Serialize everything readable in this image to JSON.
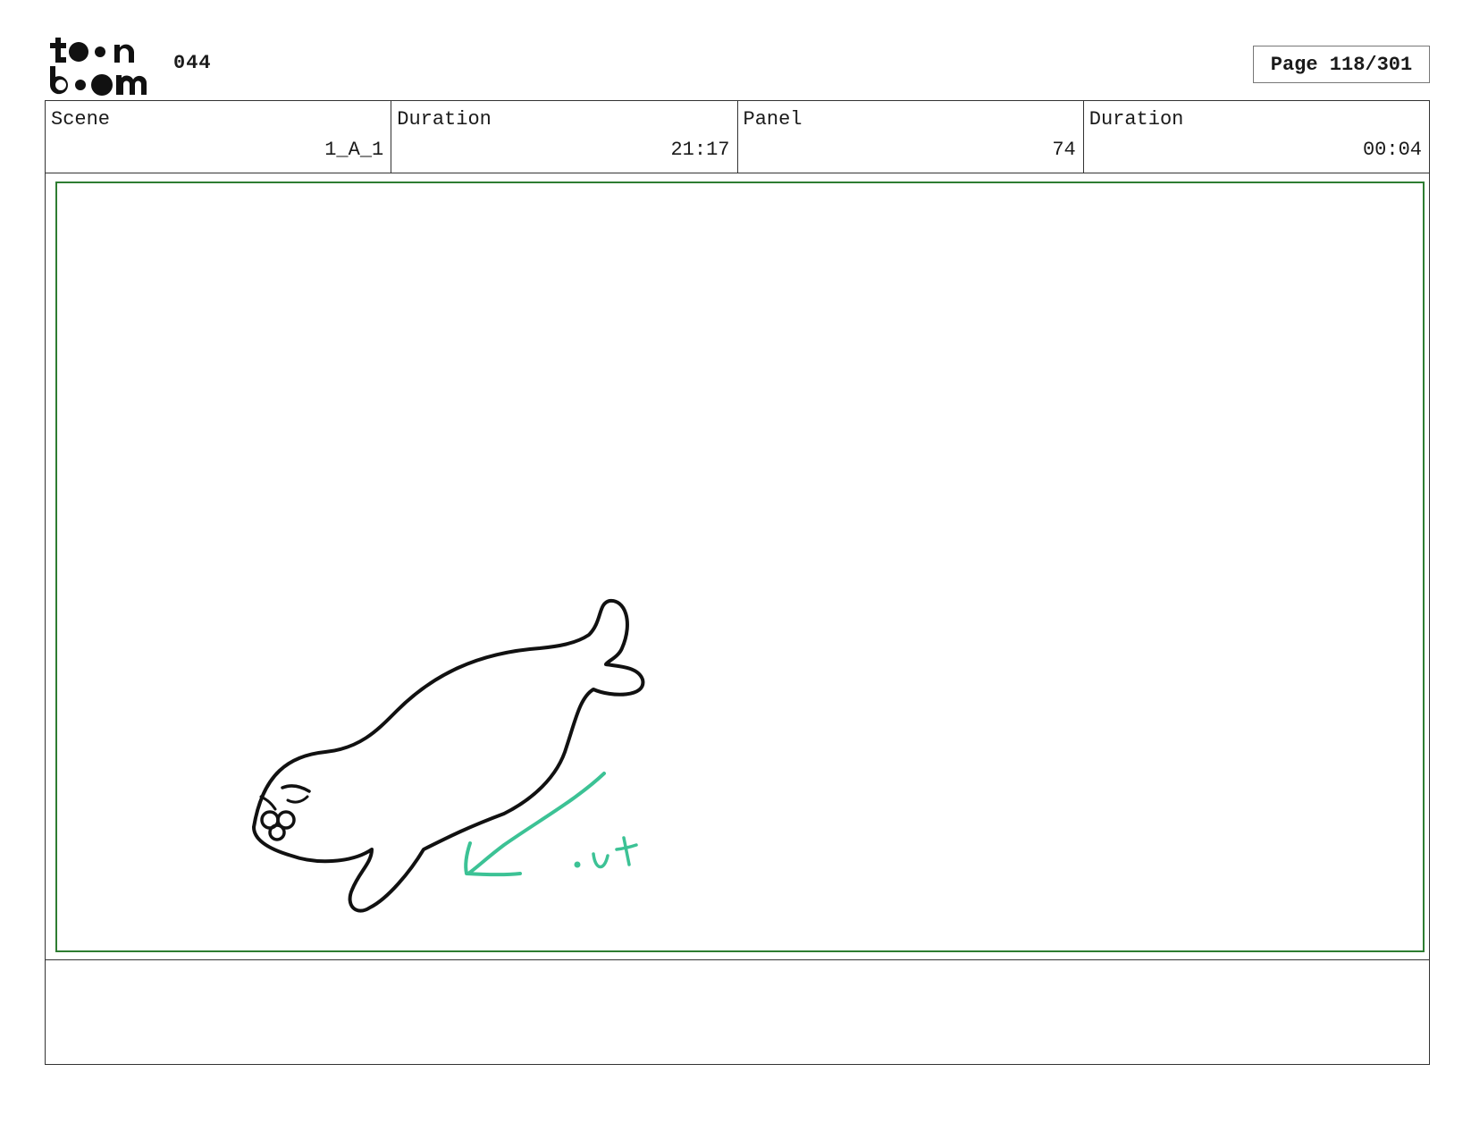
{
  "header": {
    "logo": {
      "line1": "toon",
      "line2": "boom"
    },
    "doc_number": "044",
    "page_label": "Page 118/301"
  },
  "info": {
    "scene": {
      "label": "Scene",
      "value": "1_A_1"
    },
    "scene_duration": {
      "label": "Duration",
      "value": "21:17"
    },
    "panel": {
      "label": "Panel",
      "value": "74"
    },
    "panel_duration": {
      "label": "Duration",
      "value": "00:04"
    }
  },
  "panel_sketch": {
    "annotation_text": "out",
    "colors": {
      "frame": "#2e7d32",
      "sketch_stroke": "#111111",
      "annotation_stroke": "#3cc295"
    }
  },
  "notes": {}
}
